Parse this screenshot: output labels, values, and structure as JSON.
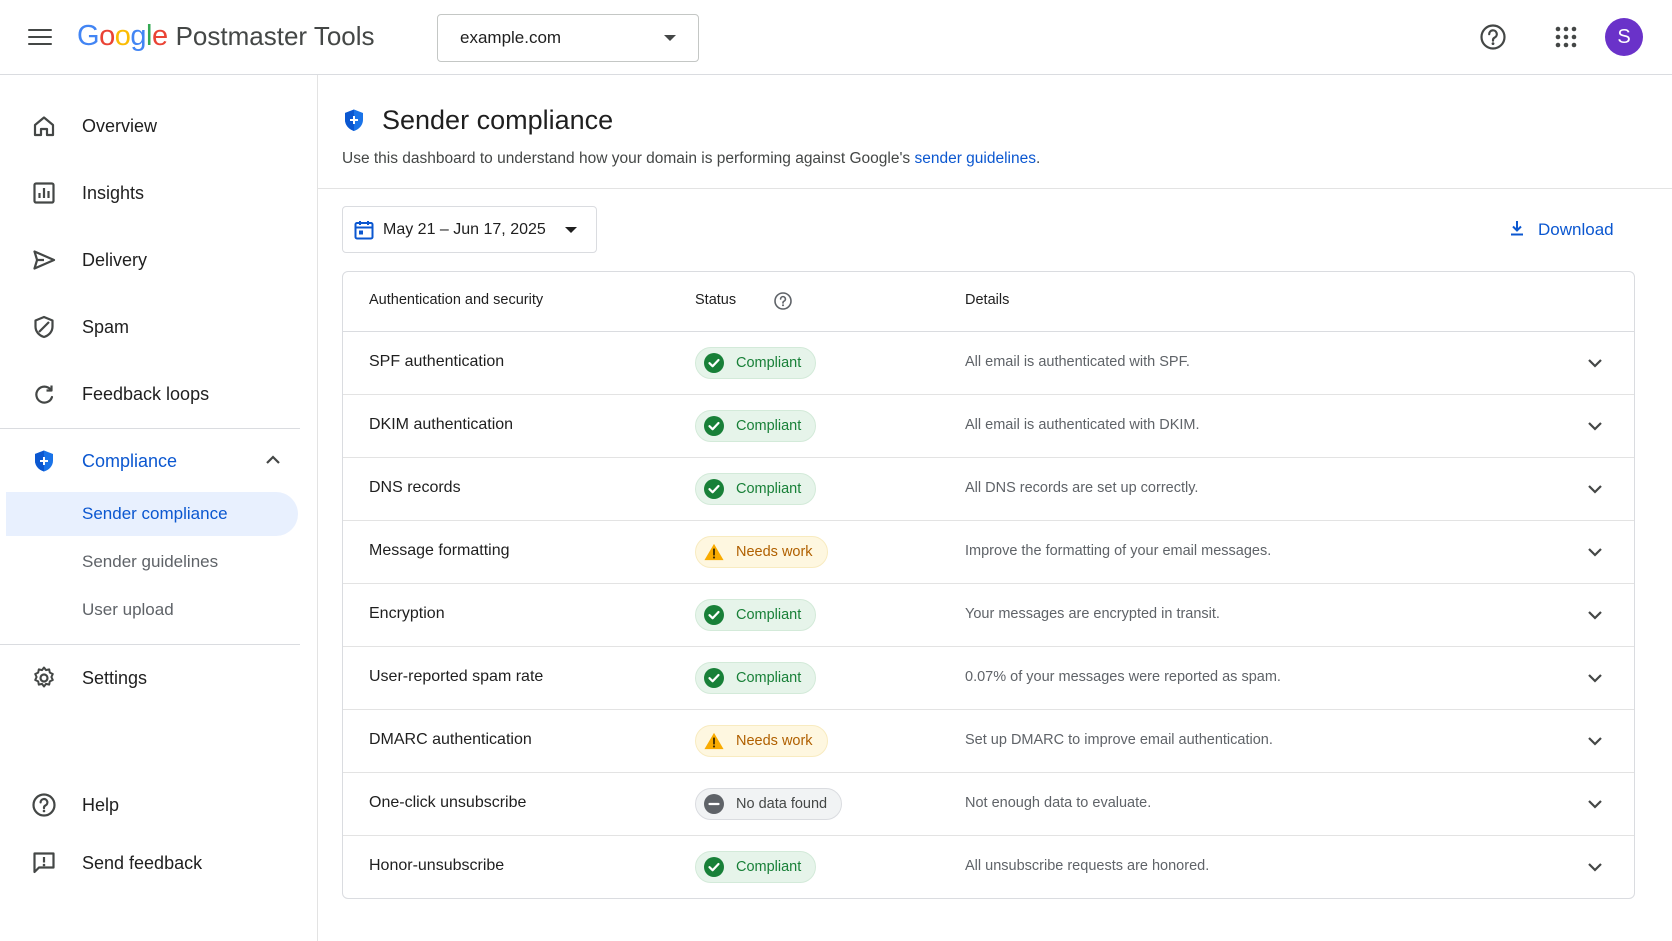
{
  "header": {
    "logo_letters": [
      "G",
      "o",
      "o",
      "g",
      "l",
      "e"
    ],
    "product_name": "Postmaster Tools",
    "domain": "example.com",
    "avatar_initial": "S"
  },
  "sidebar": {
    "items": [
      {
        "label": "Overview",
        "icon": "home-icon"
      },
      {
        "label": "Insights",
        "icon": "bar-chart-icon"
      },
      {
        "label": "Delivery",
        "icon": "send-icon"
      },
      {
        "label": "Spam",
        "icon": "shield-slash-icon"
      },
      {
        "label": "Feedback loops",
        "icon": "loop-icon"
      }
    ],
    "compliance": {
      "label": "Compliance",
      "icon": "shield-icon"
    },
    "compliance_sub": [
      {
        "label": "Sender compliance",
        "selected": true
      },
      {
        "label": "Sender guidelines",
        "selected": false
      },
      {
        "label": "User upload",
        "selected": false
      }
    ],
    "settings": {
      "label": "Settings",
      "icon": "gear-icon"
    },
    "help": {
      "label": "Help",
      "icon": "help-icon"
    },
    "feedback": {
      "label": "Send feedback",
      "icon": "feedback-icon"
    }
  },
  "main": {
    "title": "Sender compliance",
    "description_prefix": "Use this dashboard to understand how your domain is performing against Google's ",
    "description_link": "sender guidelines",
    "description_suffix": ".",
    "date_range": "May 21 – Jun 17, 2025",
    "download_label": "Download",
    "table": {
      "headers": {
        "name": "Authentication and security",
        "status": "Status",
        "details": "Details"
      },
      "rows": [
        {
          "name": "SPF authentication",
          "status": "Compliant",
          "kind": "ok",
          "details": "All email is authenticated with SPF."
        },
        {
          "name": "DKIM authentication",
          "status": "Compliant",
          "kind": "ok",
          "details": "All email is authenticated with DKIM."
        },
        {
          "name": "DNS records",
          "status": "Compliant",
          "kind": "ok",
          "details": "All DNS records are set up correctly."
        },
        {
          "name": "Message formatting",
          "status": "Needs work",
          "kind": "warn",
          "details": "Improve the formatting of your email messages."
        },
        {
          "name": "Encryption",
          "status": "Compliant",
          "kind": "ok",
          "details": "Your messages are encrypted in transit."
        },
        {
          "name": "User-reported spam rate",
          "status": "Compliant",
          "kind": "ok",
          "details": "0.07% of your messages were reported as spam."
        },
        {
          "name": "DMARC authentication",
          "status": "Needs work",
          "kind": "warn",
          "details": "Set up DMARC to improve email authentication."
        },
        {
          "name": "One-click unsubscribe",
          "status": "No data found",
          "kind": "none",
          "details": "Not enough data to evaluate."
        },
        {
          "name": "Honor-unsubscribe",
          "status": "Compliant",
          "kind": "ok",
          "details": "All unsubscribe requests are honored."
        }
      ]
    }
  },
  "colors": {
    "accent": "#0b57d0",
    "ok": "#188038",
    "warn": "#f9ab00",
    "avatar": "#6a32c9"
  }
}
